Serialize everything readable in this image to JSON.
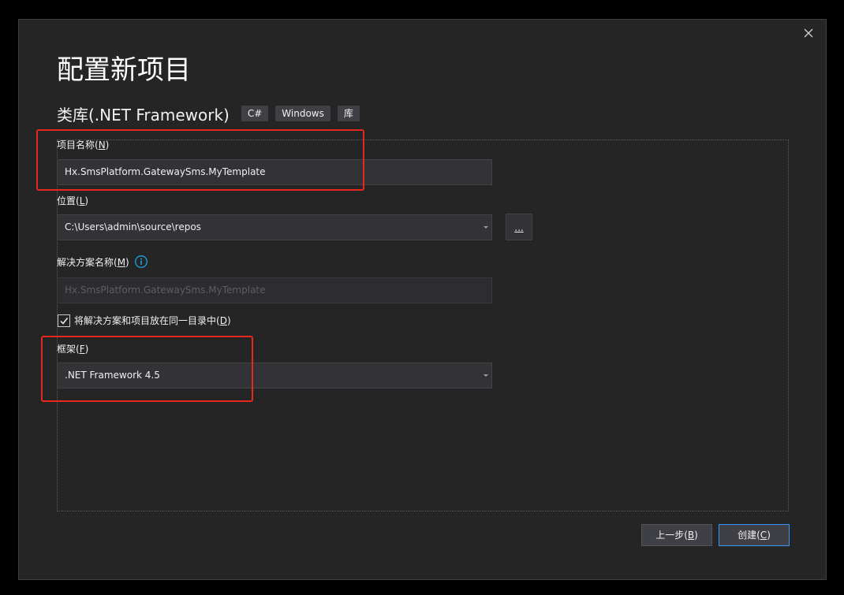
{
  "dialog": {
    "title": "配置新项目",
    "close_label": "close"
  },
  "template": {
    "name": "类库(.NET Framework)",
    "tags": [
      "C#",
      "Windows",
      "库"
    ]
  },
  "project_name": {
    "label": "项目名称(",
    "accel": "N",
    "label_end": ")",
    "value": "Hx.SmsPlatform.GatewaySms.MyTemplate"
  },
  "location": {
    "label": "位置(",
    "accel": "L",
    "label_end": ")",
    "value": "C:\\Users\\admin\\source\\repos",
    "browse_label": "..."
  },
  "solution_name": {
    "label": "解决方案名称(",
    "accel": "M",
    "label_end": ")",
    "value": "Hx.SmsPlatform.GatewaySms.MyTemplate"
  },
  "same_dir": {
    "label": "将解决方案和项目放在同一目录中(",
    "accel": "D",
    "label_end": ")",
    "checked": true
  },
  "framework": {
    "label": "框架(",
    "accel": "F",
    "label_end": ")",
    "value": ".NET Framework 4.5"
  },
  "buttons": {
    "back": "上一步(",
    "back_accel": "B",
    "back_end": ")",
    "create": "创建(",
    "create_accel": "C",
    "create_end": ")"
  },
  "colors": {
    "background": "#252526",
    "highlight": "#e8281e",
    "accent": "#3399ff",
    "info": "#1ba1e2"
  }
}
